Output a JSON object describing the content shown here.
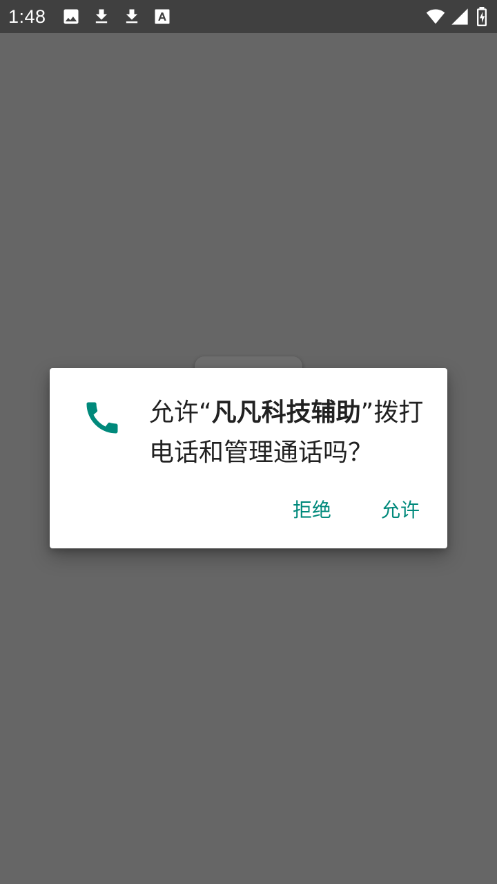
{
  "status_bar": {
    "time": "1:48",
    "notification_icons": [
      "image-icon",
      "download-icon",
      "download-icon",
      "font-a-icon"
    ],
    "system_icons": [
      "wifi-icon",
      "signal-icon",
      "battery-charging-icon"
    ]
  },
  "dialog": {
    "icon": "phone-icon",
    "message_prefix": "允许“",
    "app_name": "凡凡科技辅助",
    "message_suffix": "”拨打电话和管理通话吗？",
    "deny_label": "拒绝",
    "allow_label": "允许"
  },
  "colors": {
    "accent": "#00897b",
    "scrim": "#666666",
    "status_bar": "#404040",
    "dialog_bg": "#ffffff",
    "text_primary": "#212121"
  }
}
